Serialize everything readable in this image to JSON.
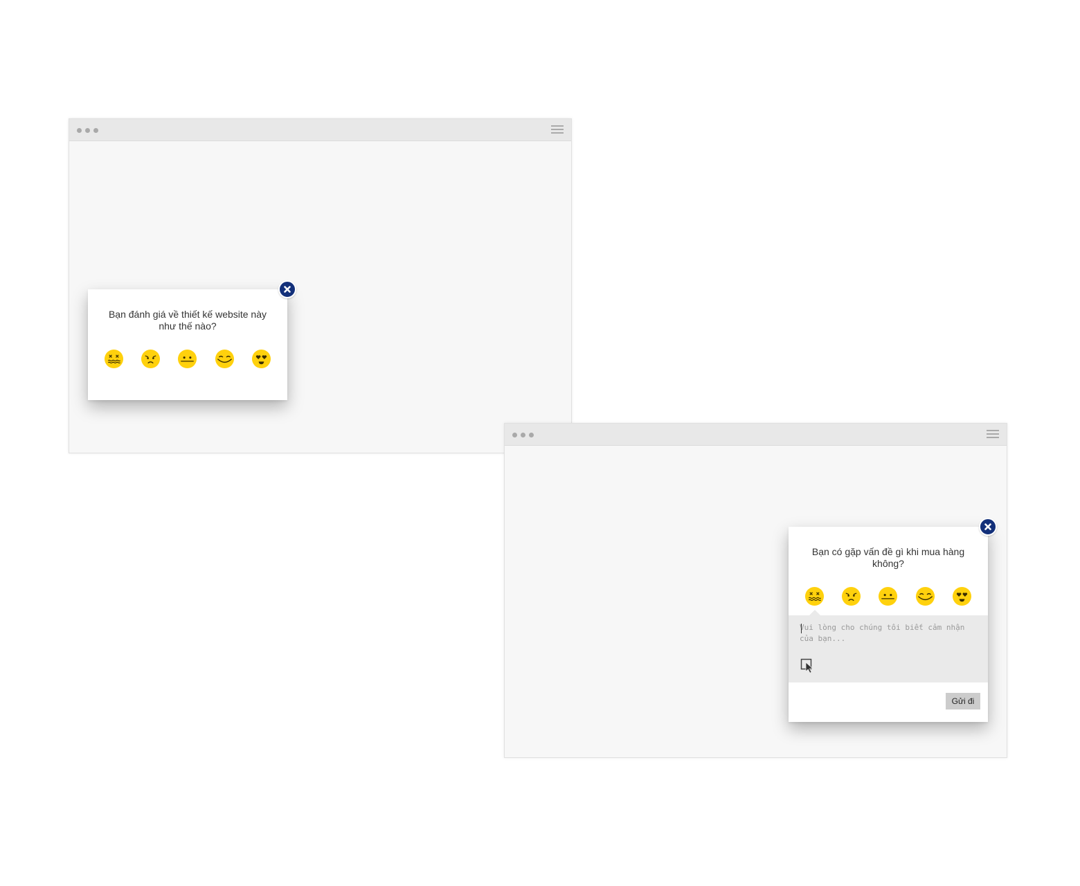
{
  "colors": {
    "emoji_yellow": "#ffd10d",
    "close_button": "#13307a",
    "browser_bg": "#f7f7f7",
    "titlebar_bg": "#e8e8e8"
  },
  "window_1": {
    "question": "Bạn đánh giá về thiết kế website này như thế nào?",
    "emojis": [
      "dizzy-face-icon",
      "sad-face-icon",
      "neutral-face-icon",
      "smile-face-icon",
      "heart-eyes-icon"
    ]
  },
  "window_2": {
    "question": "Bạn có gặp vấn đề gì khi mua hàng không?",
    "emojis": [
      "dizzy-face-icon",
      "sad-face-icon",
      "neutral-face-icon",
      "smile-face-icon",
      "heart-eyes-icon"
    ],
    "feedback_placeholder": "Vui lòng cho chúng tôi biết cảm nhận của bạn...",
    "submit_label": "Gửi đi"
  }
}
